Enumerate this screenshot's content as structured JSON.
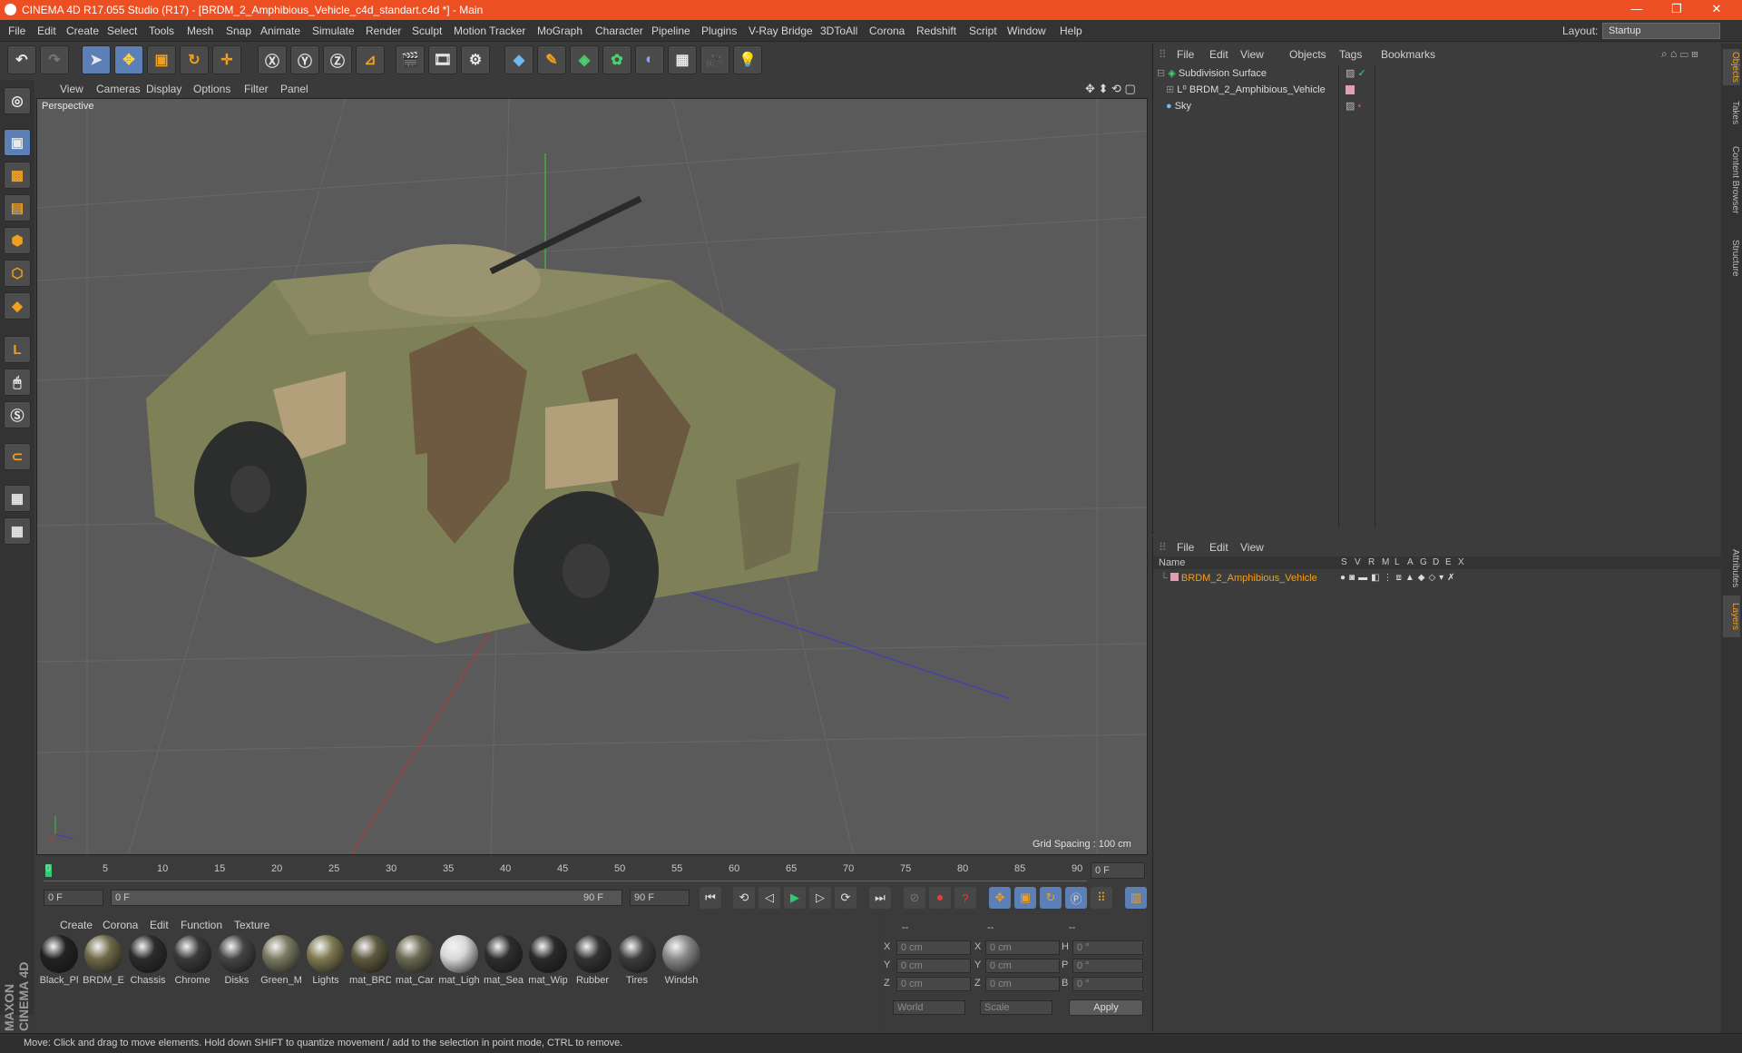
{
  "window": {
    "title": "CINEMA 4D R17.055 Studio (R17) - [BRDM_2_Amphibious_Vehicle_c4d_standart.c4d *] - Main",
    "controls": [
      "—",
      "❐",
      "✕"
    ]
  },
  "menu": [
    "File",
    "Edit",
    "Create",
    "Select",
    "Tools",
    "Mesh",
    "Snap",
    "Animate",
    "Simulate",
    "Render",
    "Sculpt",
    "Motion Tracker",
    "MoGraph",
    "Character",
    "Pipeline",
    "Plugins",
    "V-Ray Bridge",
    "3DToAll",
    "Corona",
    "Redshift",
    "Script",
    "Window",
    "Help"
  ],
  "layout": {
    "label": "Layout:",
    "value": "Startup"
  },
  "viewport": {
    "menu": [
      "View",
      "Cameras",
      "Display",
      "Options",
      "Filter",
      "Panel"
    ],
    "camera": "Perspective",
    "grid_spacing": "Grid Spacing : 100 cm"
  },
  "timeline": {
    "ticks": [
      "0",
      "5",
      "10",
      "15",
      "20",
      "25",
      "30",
      "35",
      "40",
      "45",
      "50",
      "55",
      "60",
      "65",
      "70",
      "75",
      "80",
      "85",
      "90"
    ],
    "current": "0 F",
    "start": "0 F",
    "range_start": "0 F",
    "range_end": "90 F",
    "end": "90 F"
  },
  "materials": {
    "menu": [
      "Create",
      "Corona",
      "Edit",
      "Function",
      "Texture"
    ],
    "items": [
      {
        "label": "Black_Pl",
        "color": "#222"
      },
      {
        "label": "BRDM_E",
        "color": "#6e6a48"
      },
      {
        "label": "Chassis",
        "color": "#2c2c2c"
      },
      {
        "label": "Chrome",
        "color": "#3a3a3a"
      },
      {
        "label": "Disks",
        "color": "#444"
      },
      {
        "label": "Green_M",
        "color": "#7a7a62"
      },
      {
        "label": "Lights",
        "color": "#807a52"
      },
      {
        "label": "mat_BRD",
        "color": "#5e5a3e"
      },
      {
        "label": "mat_Car",
        "color": "#6b6a52"
      },
      {
        "label": "mat_Ligh",
        "color": "#d8d8d8"
      },
      {
        "label": "mat_Sea",
        "color": "#2e2e2e"
      },
      {
        "label": "mat_Wip",
        "color": "#2a2a2a"
      },
      {
        "label": "Rubber",
        "color": "#333"
      },
      {
        "label": "Tires",
        "color": "#3c3c3c"
      },
      {
        "label": "Windsh",
        "color": "#8a8a8a"
      }
    ]
  },
  "coords": {
    "headers": [
      "--",
      "--",
      "--"
    ],
    "rows": [
      {
        "a": "X",
        "av": "0 cm",
        "b": "X",
        "bv": "0 cm",
        "c": "H",
        "cv": "0 °"
      },
      {
        "a": "Y",
        "av": "0 cm",
        "b": "Y",
        "bv": "0 cm",
        "c": "P",
        "cv": "0 °"
      },
      {
        "a": "Z",
        "av": "0 cm",
        "b": "Z",
        "bv": "0 cm",
        "c": "B",
        "cv": "0 °"
      }
    ],
    "mode": "World",
    "scale": "Scale",
    "apply": "Apply"
  },
  "objects": {
    "menu": [
      "File",
      "Edit",
      "View",
      "Objects",
      "Tags",
      "Bookmarks"
    ],
    "items": [
      {
        "name": "Subdivision Surface",
        "icon": "subdivision-icon"
      },
      {
        "name": "BRDM_2_Amphibious_Vehicle",
        "icon": "null-object-icon"
      },
      {
        "name": "Sky",
        "icon": "sky-icon"
      }
    ]
  },
  "layers": {
    "menu": [
      "File",
      "Edit",
      "View"
    ],
    "columns": [
      "Name",
      "S",
      "V",
      "R",
      "M",
      "L",
      "A",
      "G",
      "D",
      "E",
      "X"
    ],
    "rows": [
      {
        "name": "BRDM_2_Amphibious_Vehicle",
        "color": "#e0a0b0"
      }
    ]
  },
  "side_tabs": [
    "Objects",
    "Takes",
    "Content Browser",
    "Structure"
  ],
  "side_tabs_lower": [
    "Attributes",
    "Layers"
  ],
  "brand": "MAXON CINEMA 4D",
  "status": "Move: Click and drag to move elements. Hold down SHIFT to quantize movement / add to the selection in point mode, CTRL to remove.",
  "colors": {
    "title_bar": "#ec5022",
    "accent": "#5c7fb5",
    "layer_name": "#f0a020"
  }
}
